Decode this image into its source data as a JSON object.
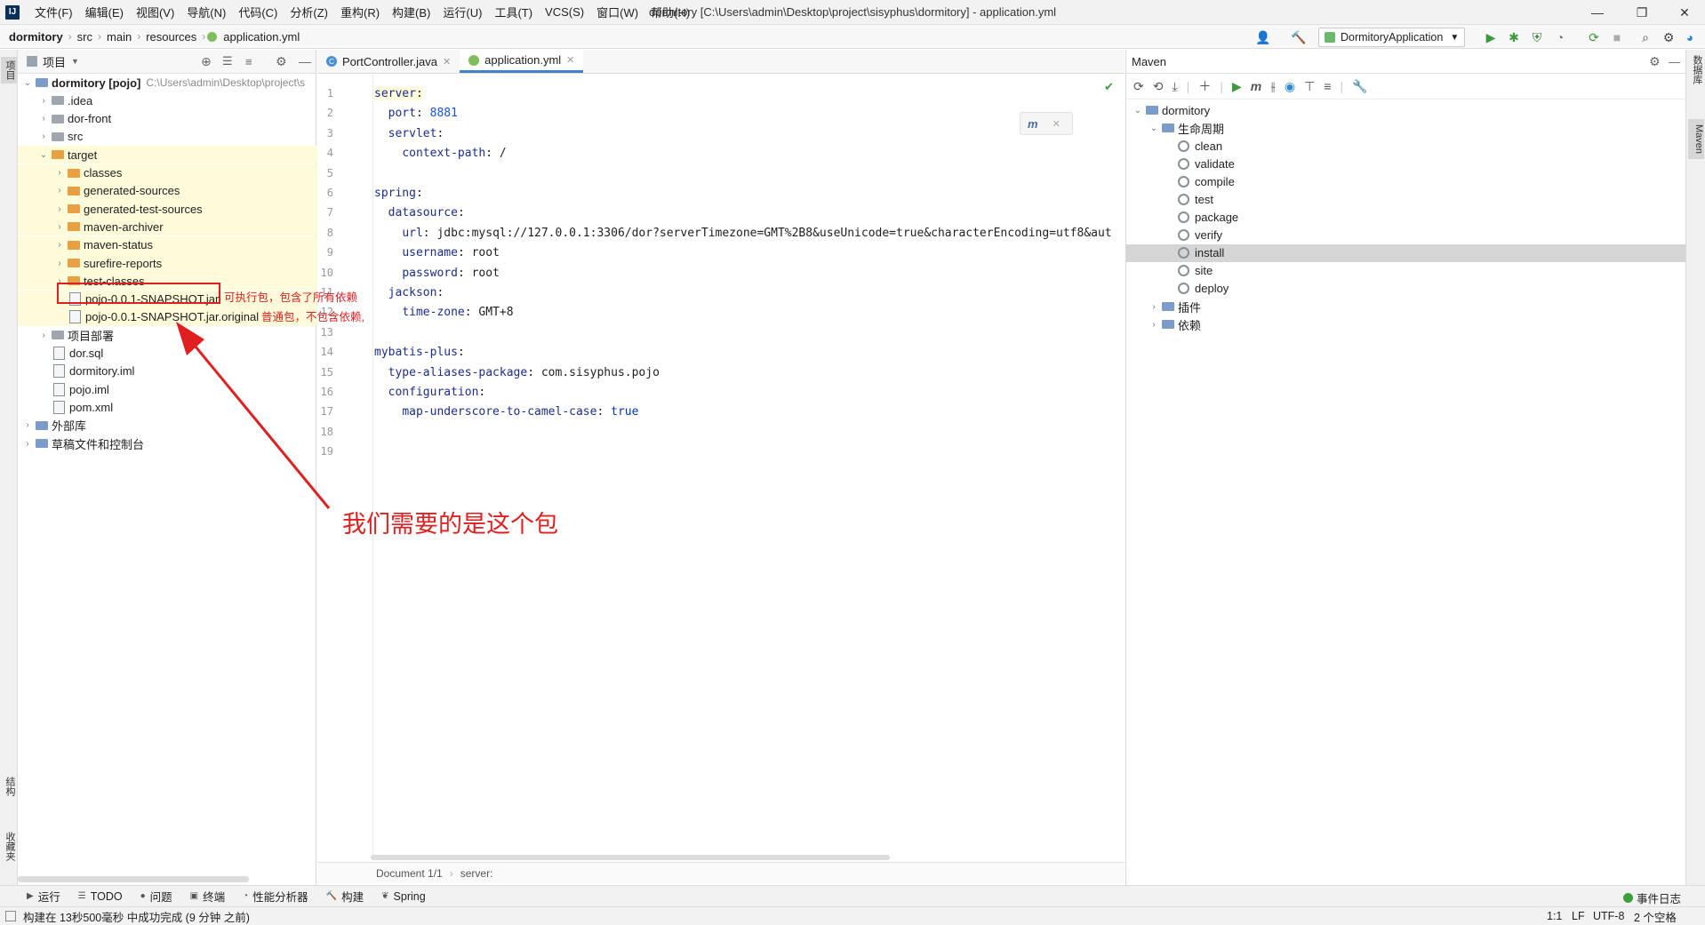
{
  "titlebar": {
    "menu": [
      "文件(F)",
      "编辑(E)",
      "视图(V)",
      "导航(N)",
      "代码(C)",
      "分析(Z)",
      "重构(R)",
      "构建(B)",
      "运行(U)",
      "工具(T)",
      "VCS(S)",
      "窗口(W)",
      "帮助(H)"
    ],
    "window_title": "dormitory [C:\\Users\\admin\\Desktop\\project\\sisyphus\\dormitory] - application.yml",
    "minimize": "—",
    "maximize": "❐",
    "close": "✕"
  },
  "navbar": {
    "breadcrumbs": [
      "dormitory",
      "src",
      "main",
      "resources",
      "application.yml"
    ],
    "run_config": "DormitoryApplication"
  },
  "left_strip": {
    "project_tab": "项目",
    "structure_tab": "结构",
    "favorites_tab": "收藏夹"
  },
  "project": {
    "header": "项目",
    "tree": [
      {
        "label": "dormitory [pojo]",
        "path": "C:\\Users\\admin\\Desktop\\project\\s",
        "arrow": "⌄"
      },
      {
        "label": ".idea",
        "arrow": "›"
      },
      {
        "label": "dor-front",
        "arrow": "›"
      },
      {
        "label": "src",
        "arrow": "›"
      },
      {
        "label": "target",
        "arrow": "⌄"
      },
      {
        "label": "classes",
        "arrow": "›"
      },
      {
        "label": "generated-sources",
        "arrow": "›"
      },
      {
        "label": "generated-test-sources",
        "arrow": "›"
      },
      {
        "label": "maven-archiver",
        "arrow": "›"
      },
      {
        "label": "maven-status",
        "arrow": "›"
      },
      {
        "label": "surefire-reports",
        "arrow": "›"
      },
      {
        "label": "test-classes",
        "arrow": "›"
      },
      {
        "label": "pojo-0.0.1-SNAPSHOT.jar"
      },
      {
        "label": "pojo-0.0.1-SNAPSHOT.jar.original"
      },
      {
        "label": "项目部署",
        "arrow": "›"
      },
      {
        "label": "dor.sql"
      },
      {
        "label": "dormitory.iml"
      },
      {
        "label": "pojo.iml"
      },
      {
        "label": "pom.xml"
      },
      {
        "label": "外部库",
        "arrow": "›"
      },
      {
        "label": "草稿文件和控制台",
        "arrow": "›"
      }
    ]
  },
  "editor": {
    "tabs": [
      "PortController.java",
      "application.yml"
    ],
    "lines": [
      {
        "n": "1",
        "parts": [
          [
            "k",
            "server"
          ],
          [
            "p",
            ":"
          ]
        ]
      },
      {
        "n": "2",
        "parts": [
          [
            "p",
            "  "
          ],
          [
            "k",
            "port"
          ],
          [
            "p",
            ": "
          ],
          [
            "n",
            "8881"
          ]
        ]
      },
      {
        "n": "3",
        "parts": [
          [
            "p",
            "  "
          ],
          [
            "k",
            "servlet"
          ],
          [
            "p",
            ":"
          ]
        ]
      },
      {
        "n": "4",
        "parts": [
          [
            "p",
            "    "
          ],
          [
            "k",
            "context-path"
          ],
          [
            "p",
            ": /"
          ]
        ]
      },
      {
        "n": "5",
        "parts": []
      },
      {
        "n": "6",
        "parts": [
          [
            "k",
            "spring"
          ],
          [
            "p",
            ":"
          ]
        ]
      },
      {
        "n": "7",
        "parts": [
          [
            "p",
            "  "
          ],
          [
            "k",
            "datasource"
          ],
          [
            "p",
            ":"
          ]
        ]
      },
      {
        "n": "8",
        "parts": [
          [
            "p",
            "    "
          ],
          [
            "k",
            "url"
          ],
          [
            "p",
            ": jdbc:mysql://127.0.0.1:3306/dor?serverTimezone=GMT%2B8&useUnicode=true&characterEncoding=utf8&aut"
          ]
        ]
      },
      {
        "n": "9",
        "parts": [
          [
            "p",
            "    "
          ],
          [
            "k",
            "username"
          ],
          [
            "p",
            ": root"
          ]
        ]
      },
      {
        "n": "10",
        "parts": [
          [
            "p",
            "    "
          ],
          [
            "k",
            "password"
          ],
          [
            "p",
            ": root"
          ]
        ]
      },
      {
        "n": "11",
        "parts": [
          [
            "p",
            "  "
          ],
          [
            "k",
            "jackson"
          ],
          [
            "p",
            ":"
          ]
        ]
      },
      {
        "n": "12",
        "parts": [
          [
            "p",
            "    "
          ],
          [
            "k",
            "time-zone"
          ],
          [
            "p",
            ": GMT+8"
          ]
        ]
      },
      {
        "n": "13",
        "parts": []
      },
      {
        "n": "14",
        "parts": [
          [
            "k",
            "mybatis-plus"
          ],
          [
            "p",
            ":"
          ]
        ]
      },
      {
        "n": "15",
        "parts": [
          [
            "p",
            "  "
          ],
          [
            "k",
            "type-aliases-package"
          ],
          [
            "p",
            ": com.sisyphus.pojo"
          ]
        ]
      },
      {
        "n": "16",
        "parts": [
          [
            "p",
            "  "
          ],
          [
            "k",
            "configuration"
          ],
          [
            "p",
            ":"
          ]
        ]
      },
      {
        "n": "17",
        "parts": [
          [
            "p",
            "    "
          ],
          [
            "k",
            "map-underscore-to-camel-case"
          ],
          [
            "p",
            ": "
          ],
          [
            "b",
            "true"
          ]
        ]
      },
      {
        "n": "18",
        "parts": []
      },
      {
        "n": "19",
        "parts": []
      }
    ],
    "status_doc": "Document 1/1",
    "status_path": "server:"
  },
  "maven": {
    "title": "Maven",
    "root": "dormitory",
    "lifecycle": "生命周期",
    "goals": [
      "clean",
      "validate",
      "compile",
      "test",
      "package",
      "verify",
      "install",
      "site",
      "deploy"
    ],
    "selected_goal": "install",
    "plugins": "插件",
    "dependencies": "依赖",
    "side_tab": "Maven",
    "db_tab": "数据库"
  },
  "tool_tabs": [
    "运行",
    "TODO",
    "问题",
    "终端",
    "性能分析器",
    "构建",
    "Spring"
  ],
  "statusbar": {
    "message": "构建在 13秒500毫秒 中成功完成 (9 分钟 之前)",
    "position": "1:1",
    "line_sep": "LF",
    "encoding": "UTF-8",
    "indent": "2 个空格",
    "event_log": "事件日志"
  },
  "annotations": {
    "executable_note": "可执行包，包含了所有依赖",
    "plain_note": "普通包，不包含依赖,",
    "main_note": "我们需要的是这个包"
  },
  "colors": {
    "accent": "#4083c9",
    "annotation": "#e02020",
    "highlight": "#fdfbd9",
    "selected": "#d5d5d5"
  }
}
